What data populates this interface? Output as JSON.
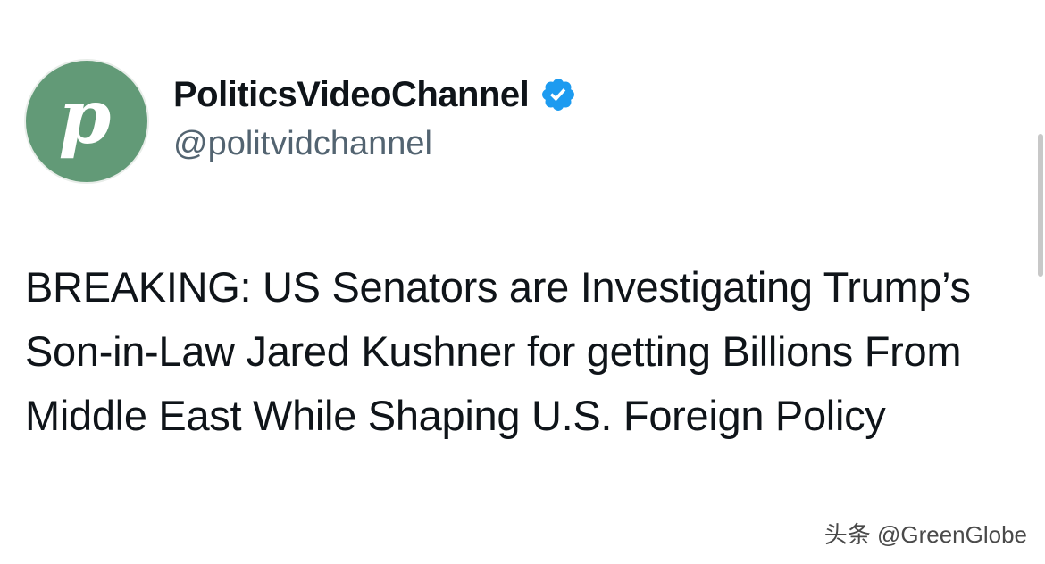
{
  "account": {
    "avatar_letter": "p",
    "avatar_color": "#629a77",
    "display_name": "PoliticsVideoChannel",
    "verified_icon": "verified-badge-icon",
    "verified_color": "#1d9bf0",
    "handle": "@politvidchannel"
  },
  "tweet": {
    "text": "BREAKING: US Senators are Investigating Trump’s Son-in-Law Jared Kushner for getting Billions From Middle East While Shaping U.S. Foreign Policy"
  },
  "watermark": {
    "text": "头条 @GreenGlobe"
  }
}
